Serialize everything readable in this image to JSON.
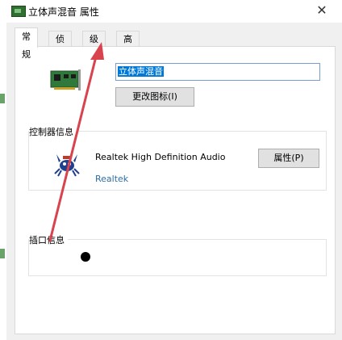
{
  "window": {
    "title": "立体声混音 属性",
    "close_glyph": "✕"
  },
  "tabs": [
    {
      "label": "常规",
      "active": true
    },
    {
      "label": "侦听",
      "active": false
    },
    {
      "label": "级别",
      "active": false
    },
    {
      "label": "高级",
      "active": false
    }
  ],
  "general": {
    "device_name": "立体声混音",
    "change_icon_label": "更改图标(I)"
  },
  "controller": {
    "section_label": "控制器信息",
    "codec_name": "Realtek High Definition Audio",
    "vendor": "Realtek",
    "properties_label": "属性(P)"
  },
  "jack": {
    "section_label": "插口信息"
  },
  "colors": {
    "annotation_arrow": "#d9434e",
    "selection": "#0078d7",
    "vendor_text": "#2c6ea3"
  },
  "icons": {
    "title": "sound-card-icon",
    "device": "sound-card-icon",
    "vendor": "realtek-crab-icon"
  }
}
